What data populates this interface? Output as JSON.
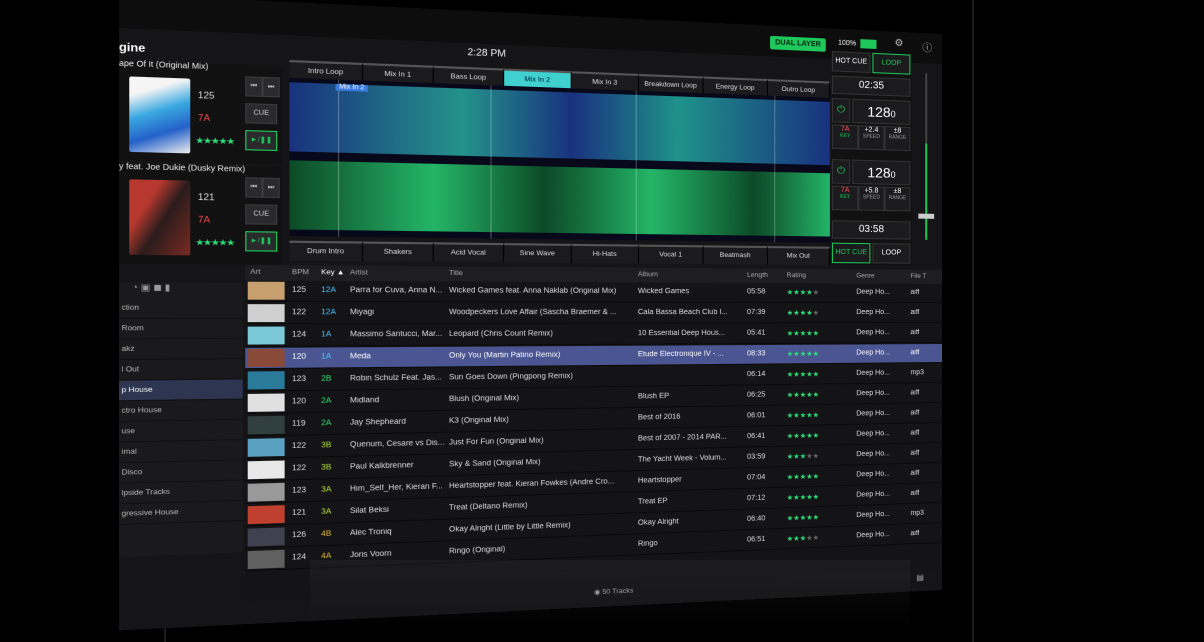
{
  "status": {
    "time": "2:28 PM",
    "layer_button": "DUAL LAYER",
    "battery": "100%"
  },
  "logo_text": "gine",
  "deck1": {
    "title": "ape Of It (Original Mix)",
    "bpm": "125",
    "key": "7A",
    "cue": "CUE",
    "play": "►/❚❚",
    "stars": "★★★★★"
  },
  "deck2": {
    "title": "y feat. Joe Dukie (Dusky Remix)",
    "bpm": "121",
    "key": "7A",
    "cue": "CUE",
    "play": "►/❚❚",
    "stars": "★★★★★"
  },
  "top_pads": [
    "Intro Loop",
    "Mix In 1",
    "Bass Loop",
    "Mix In 2",
    "Mix In 3",
    "Breakdown Loop",
    "Energy Loop",
    "Outro Loop"
  ],
  "bottom_pads": [
    "Drum Intro",
    "Shakers",
    "Acid Vocal",
    "Sine Wave",
    "Hi-Hats",
    "Vocal 1",
    "Beatmash",
    "Mix Out"
  ],
  "wave_label": "Mix In 2",
  "controls": {
    "hot_cue": "HOT CUE",
    "loop": "LOOP",
    "time_top": "02:35",
    "time_bottom": "03:58",
    "deck1": {
      "bpm": "128",
      "decimal": "0",
      "key": "7A",
      "key_label": "KEY",
      "speed": "+2.4",
      "speed_label": "SPEED",
      "range": "±8",
      "range_label": "RANGE"
    },
    "deck2": {
      "bpm": "128",
      "decimal": "0",
      "key": "7A",
      "key_label": "KEY",
      "speed": "+5.8",
      "speed_label": "SPEED",
      "range": "±8",
      "range_label": "RANGE"
    }
  },
  "sidebar": [
    "ction",
    "Room",
    "akz",
    "l Out",
    "p House",
    "ctro House",
    "use",
    "imal",
    "Disco",
    "lpside Tracks",
    "gressive House"
  ],
  "columns": [
    "Art",
    "BPM",
    "Key ▲",
    "Artist",
    "Title",
    "Album",
    "Length",
    "Rating",
    "Genre",
    "File T"
  ],
  "rows": [
    {
      "bpm": "125",
      "key": "12A",
      "artist": "Parra for Cuva, Anna N...",
      "title": "Wicked Games feat. Anna Naklab (Original Mix)",
      "album": "Wicked Games",
      "length": "05:58",
      "rating": 4,
      "genre": "Deep Ho...",
      "type": "aiff"
    },
    {
      "bpm": "122",
      "key": "12A",
      "artist": "Miyagi",
      "title": "Woodpeckers Love Affair (Sascha Braemer & ...",
      "album": "Cala Bassa Beach Club I...",
      "length": "07:39",
      "rating": 4,
      "genre": "Deep Ho...",
      "type": "aiff"
    },
    {
      "bpm": "124",
      "key": "1A",
      "artist": "Massimo Santucci, Mar...",
      "title": "Leopard (Chris Count Remix)",
      "album": "10 Essential Deep Hous...",
      "length": "05:41",
      "rating": 5,
      "genre": "Deep Ho...",
      "type": "aiff"
    },
    {
      "bpm": "120",
      "key": "1A",
      "artist": "Meda",
      "title": "Only You (Martin Patino Remix)",
      "album": "Etude Electronique IV - ...",
      "length": "08:33",
      "rating": 5,
      "genre": "Deep Ho...",
      "type": "aiff"
    },
    {
      "bpm": "123",
      "key": "2B",
      "artist": "Robin Schulz Feat. Jas...",
      "title": "Sun Goes Down (Pingpong Remix)",
      "album": "",
      "length": "06:14",
      "rating": 5,
      "genre": "Deep Ho...",
      "type": "mp3"
    },
    {
      "bpm": "120",
      "key": "2A",
      "artist": "Midland",
      "title": "Blush (Original Mix)",
      "album": "Blush EP",
      "length": "06:25",
      "rating": 5,
      "genre": "Deep Ho...",
      "type": "aiff"
    },
    {
      "bpm": "119",
      "key": "2A",
      "artist": "Jay Shepheard",
      "title": "K3 (Original Mix)",
      "album": "Best of 2016",
      "length": "06:01",
      "rating": 5,
      "genre": "Deep Ho...",
      "type": "aiff"
    },
    {
      "bpm": "122",
      "key": "3B",
      "artist": "Quenum, Cesare vs Dis...",
      "title": "Just For Fun (Original Mix)",
      "album": "Best of 2007 - 2014 PAR...",
      "length": "06:41",
      "rating": 5,
      "genre": "Deep Ho...",
      "type": "aiff"
    },
    {
      "bpm": "122",
      "key": "3B",
      "artist": "Paul Kalkbrenner",
      "title": "Sky & Sand (Original Mix)",
      "album": "The Yacht Week - Volum...",
      "length": "03:59",
      "rating": 3,
      "genre": "Deep Ho...",
      "type": "aiff"
    },
    {
      "bpm": "123",
      "key": "3A",
      "artist": "Him_Self_Her, Kieran F...",
      "title": "Heartstopper feat. Kieran Fowkes (Andre Cro...",
      "album": "Heartstopper",
      "length": "07:04",
      "rating": 5,
      "genre": "Deep Ho...",
      "type": "aiff"
    },
    {
      "bpm": "121",
      "key": "3A",
      "artist": "Silat Beksi",
      "title": "Treat (Deltano Remix)",
      "album": "Treat EP",
      "length": "07:12",
      "rating": 5,
      "genre": "Deep Ho...",
      "type": "aiff"
    },
    {
      "bpm": "126",
      "key": "4B",
      "artist": "Alec Troniq",
      "title": "Okay Alright (Little by Little Remix)",
      "album": "Okay Alright",
      "length": "06:40",
      "rating": 5,
      "genre": "Deep Ho...",
      "type": "mp3"
    },
    {
      "bpm": "124",
      "key": "4A",
      "artist": "Joris Voorn",
      "title": "Ringo (Original)",
      "album": "Ringo",
      "length": "06:51",
      "rating": 3,
      "genre": "Deep Ho...",
      "type": "aiff"
    }
  ],
  "footer": "50 Tracks",
  "colors": {
    "accent": "#1ec85a",
    "selected_row": "#4a5591",
    "active_pad": "#3fd0cf",
    "key_red": "#ff4d4d"
  },
  "icons": [
    "gear-icon",
    "info-icon",
    "sync-icon",
    "grid-view-icon"
  ]
}
